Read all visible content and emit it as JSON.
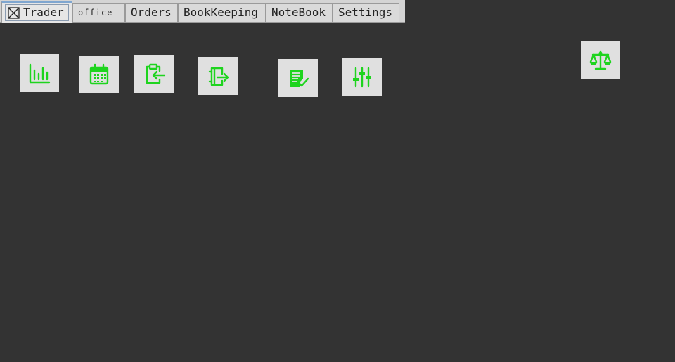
{
  "tabs": [
    {
      "label": "Trader",
      "active": true,
      "icon": "tab-close-icon"
    },
    {
      "label": "office"
    },
    {
      "label": "Orders"
    },
    {
      "label": "BookKeeping"
    },
    {
      "label": "NoteBook"
    },
    {
      "label": "Settings"
    }
  ],
  "toolbar": {
    "accent_color": "#1ed41e",
    "tile_color": "#e0e0e0",
    "background_color": "#333333",
    "icons": [
      "bar-chart-icon",
      "calendar-icon",
      "clipboard-import-icon",
      "notebook-export-icon",
      "checklist-icon",
      "sliders-icon",
      "balance-scale-icon"
    ]
  }
}
